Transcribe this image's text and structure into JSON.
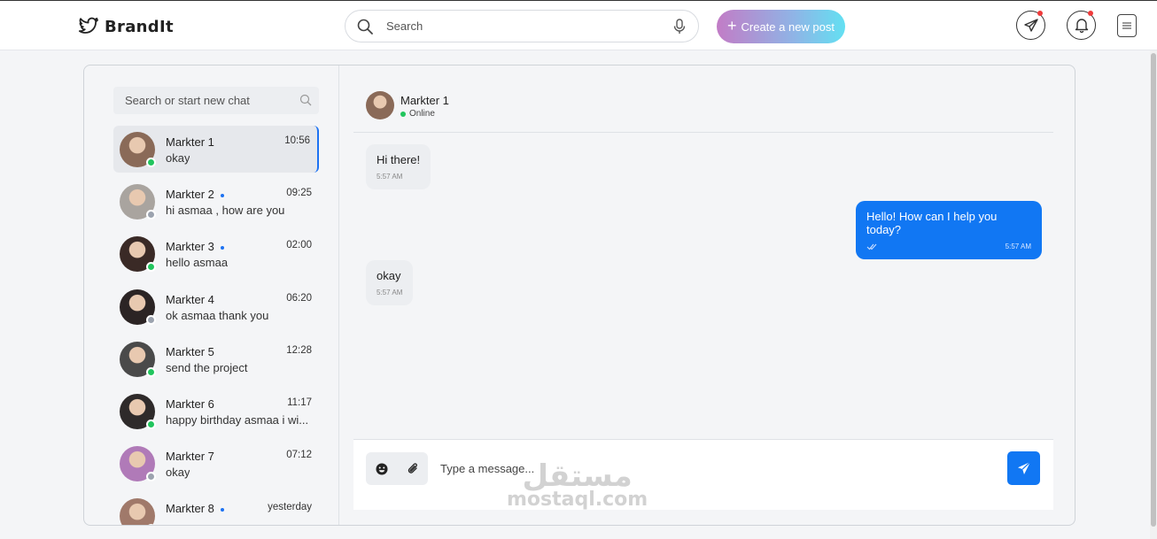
{
  "brand": {
    "name": "BrandIt"
  },
  "search": {
    "placeholder": "Search"
  },
  "create_post": {
    "label": "Create a new post"
  },
  "chat_search": {
    "placeholder": "Search or start new chat"
  },
  "conversations": [
    {
      "name": "Markter 1",
      "time": "10:56",
      "preview": "okay",
      "online": true,
      "unread": false,
      "active": true,
      "avatar_color": "#8a6a58"
    },
    {
      "name": "Markter 2",
      "time": "09:25",
      "preview": "hi asmaa , how are you",
      "online": false,
      "unread": true,
      "active": false,
      "avatar_color": "#a9a49f"
    },
    {
      "name": "Markter 3",
      "time": "02:00",
      "preview": "hello asmaa",
      "online": true,
      "unread": true,
      "active": false,
      "avatar_color": "#3a2a26"
    },
    {
      "name": "Markter 4",
      "time": "06:20",
      "preview": "ok asmaa thank you",
      "online": false,
      "unread": false,
      "active": false,
      "avatar_color": "#2b2424"
    },
    {
      "name": "Markter 5",
      "time": "12:28",
      "preview": "send the project",
      "online": true,
      "unread": false,
      "active": false,
      "avatar_color": "#4a4a4a"
    },
    {
      "name": "Markter 6",
      "time": "11:17",
      "preview": "happy birthday asmaa i wi...",
      "online": true,
      "unread": false,
      "active": false,
      "avatar_color": "#2e2a2a"
    },
    {
      "name": "Markter 7",
      "time": "07:12",
      "preview": "okay",
      "online": false,
      "unread": false,
      "active": false,
      "avatar_color": "#b07ab8"
    },
    {
      "name": "Markter 8",
      "time": "yesterday",
      "preview": "",
      "online": false,
      "unread": true,
      "active": false,
      "avatar_color": "#a0796a"
    }
  ],
  "chat": {
    "name": "Markter 1",
    "status": "Online",
    "messages": [
      {
        "direction": "in",
        "text": "Hi there!",
        "time": "5:57 AM"
      },
      {
        "direction": "out",
        "text": "Hello! How can I help you today?",
        "time": "5:57 AM"
      },
      {
        "direction": "in",
        "text": "okay",
        "time": "5:57 AM"
      }
    ]
  },
  "composer": {
    "placeholder": "Type a message..."
  },
  "watermark": {
    "arabic": "مستقل",
    "latin": "mostaql.com"
  },
  "colors": {
    "accent": "#1177f3",
    "online": "#22c55e",
    "offline": "#9ca3af",
    "notification": "#ef3b3b"
  }
}
